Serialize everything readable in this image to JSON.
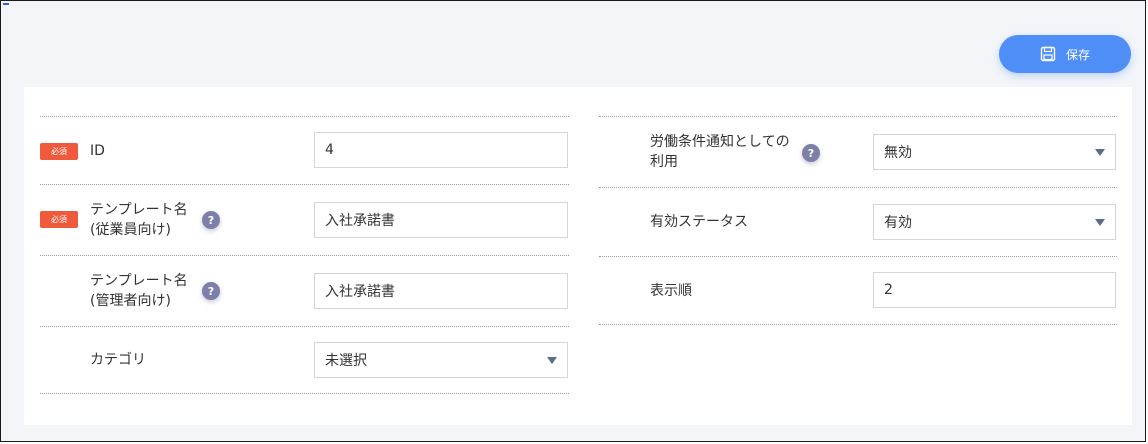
{
  "toolbar": {
    "save_label": "保存"
  },
  "required_badge": "必須",
  "help_glyph": "?",
  "left_fields": [
    {
      "label_line1": "ID",
      "label_line2": "",
      "value": "4",
      "required": true,
      "help": false,
      "type": "text"
    },
    {
      "label_line1": "テンプレート名",
      "label_line2": "(従業員向け)",
      "value": "入社承諾書",
      "required": true,
      "help": true,
      "type": "text"
    },
    {
      "label_line1": "テンプレート名",
      "label_line2": "(管理者向け)",
      "value": "入社承諾書",
      "required": false,
      "help": true,
      "type": "text"
    },
    {
      "label_line1": "カテゴリ",
      "label_line2": "",
      "value": "未選択",
      "required": false,
      "help": false,
      "type": "select"
    }
  ],
  "right_fields": [
    {
      "label_line1": "労働条件通知としての",
      "label_line2": "利用",
      "value": "無効",
      "help": true,
      "type": "select"
    },
    {
      "label_line1": "有効ステータス",
      "label_line2": "",
      "value": "有効",
      "help": false,
      "type": "select"
    },
    {
      "label_line1": "表示順",
      "label_line2": "",
      "value": "2",
      "help": false,
      "type": "text"
    }
  ],
  "colors": {
    "accent": "#4f8ef7",
    "required": "#f05a3c",
    "help": "#7c80a8"
  }
}
